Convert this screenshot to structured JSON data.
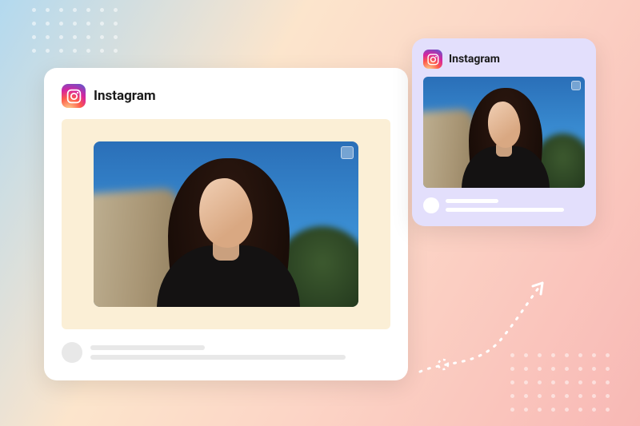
{
  "brand_name": "Instagram",
  "cards": {
    "large": {
      "label": "Instagram"
    },
    "small": {
      "label": "Instagram"
    }
  },
  "colors": {
    "card_large_bg": "#ffffff",
    "card_small_bg": "#e3dffc",
    "media_frame_bg": "#fbefd6",
    "placeholder": "#e8e8e8"
  }
}
